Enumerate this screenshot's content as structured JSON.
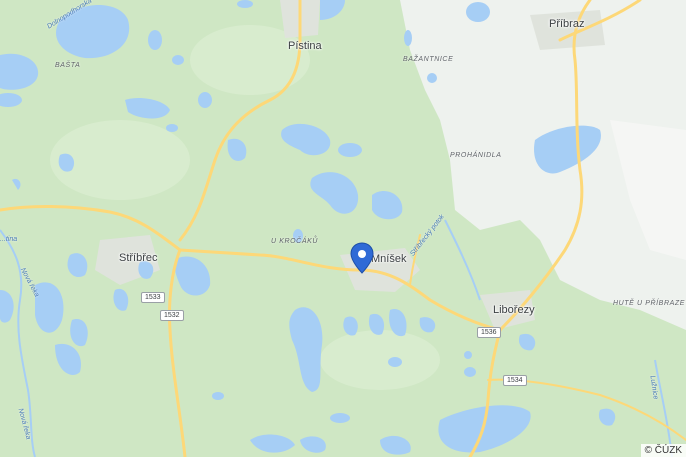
{
  "map": {
    "towns": [
      {
        "id": "pistina",
        "name": "Pístina"
      },
      {
        "id": "pribraz",
        "name": "Příbraz"
      },
      {
        "id": "stribrec",
        "name": "Stříbřec"
      },
      {
        "id": "mnisek",
        "name": "Mníšek"
      },
      {
        "id": "liborezy",
        "name": "Libořezy"
      }
    ],
    "area_labels": [
      {
        "id": "basta",
        "text": "BAŠTA"
      },
      {
        "id": "bazantnice",
        "text": "BAŽANTNICE"
      },
      {
        "id": "prohanidla",
        "text": "PROHÁNIDLA"
      },
      {
        "id": "u-krocaku",
        "text": "U KROČÁKŮ"
      },
      {
        "id": "hute",
        "text": "HUTĚ U PŘÍBRAZE"
      }
    ],
    "water_labels": [
      {
        "id": "w1",
        "text": "Dolnopodhorská"
      },
      {
        "id": "w2",
        "text": "Nová řeka"
      },
      {
        "id": "w3",
        "text": "Nová řeka"
      },
      {
        "id": "w4",
        "text": "Stříbřecký potok"
      },
      {
        "id": "w5",
        "text": "Lužnice"
      },
      {
        "id": "w6",
        "text": "...tina"
      }
    ],
    "road_shields": [
      "1533",
      "1532",
      "1536",
      "1534"
    ],
    "attribution": "© ČÚZK",
    "colors": {
      "forest": "#cfe7c4",
      "open_land": "#eef2ee",
      "water": "#a6cef5",
      "road": "#fdd878",
      "pin": "#2f6ad6"
    },
    "pin_icon": "location-pin-icon"
  }
}
